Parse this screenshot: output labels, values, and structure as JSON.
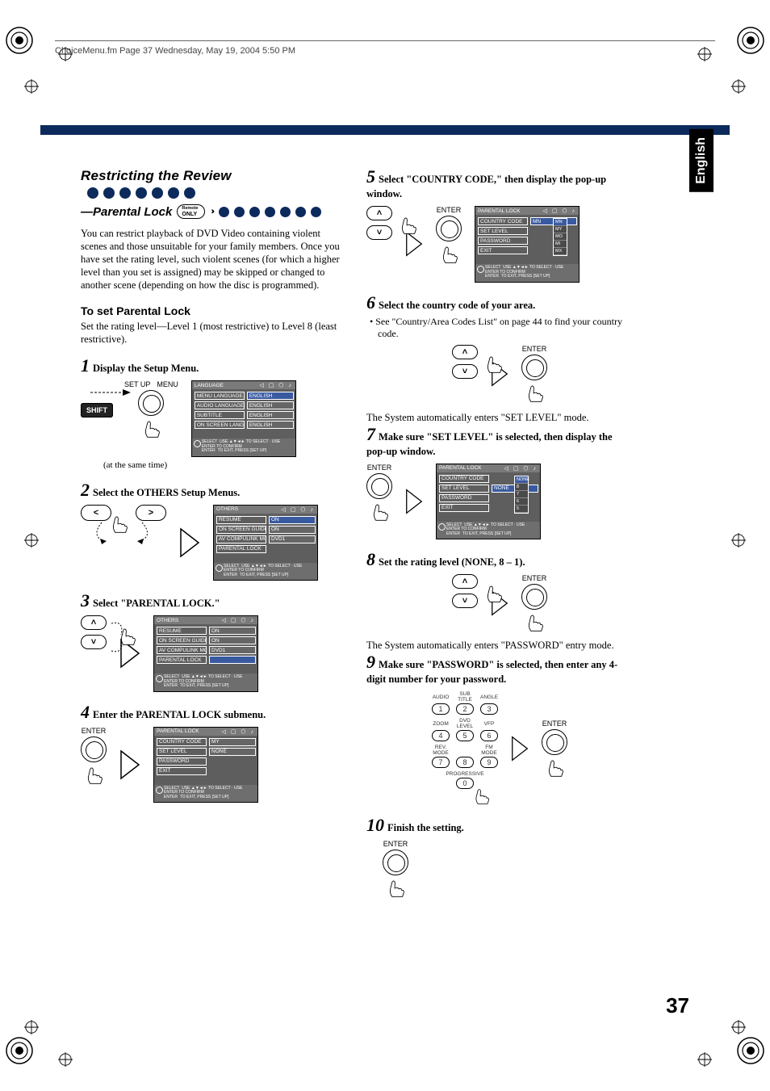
{
  "page_header": "ChoiceMenu.fm  Page 37  Wednesday, May 19, 2004  5:50 PM",
  "tab": "English",
  "page_number": "37",
  "section": {
    "title": "Restricting the Review",
    "subtitle_prefix": "—Parental Lock",
    "remote_badge_top": "Remote",
    "remote_badge_bottom": "ONLY",
    "intro": "You can restrict playback of DVD Video containing violent scenes and those unsuitable for your family members. Once you have set the rating level, such violent scenes (for which a higher level than you set is assigned) may be skipped or changed to another scene (depending on how the disc is programmed).",
    "subhead": "To set Parental Lock",
    "subhead_body": "Set the rating level—Level 1 (most restrictive) to Level 8 (least restrictive)."
  },
  "steps": {
    "s1": {
      "num": "1",
      "text": "Display the Setup Menu.",
      "caption": "(at the same time)",
      "btn_shift": "SHIFT",
      "lbl_menu": "MENU",
      "lbl_setup": "SET UP"
    },
    "s2": {
      "num": "2",
      "text": "Select the OTHERS Setup Menus."
    },
    "s3": {
      "num": "3",
      "text": "Select \"PARENTAL LOCK.\""
    },
    "s4": {
      "num": "4",
      "text": "Enter the PARENTAL LOCK submenu.",
      "lbl_enter": "ENTER"
    },
    "s5": {
      "num": "5",
      "text": "Select \"COUNTRY CODE,\" then display the pop-up window.",
      "lbl_enter": "ENTER"
    },
    "s6": {
      "num": "6",
      "text": "Select the country code of your area.",
      "bullet": "• See \"Country/Area Codes List\" on page 44  to find your country code.",
      "lbl_enter": "ENTER"
    },
    "s7": {
      "pre": "The System automatically enters \"SET  LEVEL\" mode.",
      "num": "7",
      "text": "Make sure \"SET LEVEL\" is selected, then display the pop-up window.",
      "lbl_enter": "ENTER"
    },
    "s8": {
      "num": "8",
      "text": "Set the rating level (NONE, 8 – 1).",
      "lbl_enter": "ENTER"
    },
    "s9": {
      "pre": "The System automatically enters \"PASSWORD\" entry mode.",
      "num": "9",
      "text": "Make sure \"PASSWORD\" is selected, then enter any 4-digit number for your password.",
      "lbl_enter": "ENTER"
    },
    "s10": {
      "num": "10",
      "text": "Finish the setting.",
      "lbl_enter": "ENTER"
    }
  },
  "screens": {
    "footer_l1": "USE ▲▼◄► TO SELECT · USE ENTER TO CONFIRM",
    "footer_l2": "TO EXIT, PRESS [SET UP]",
    "footer_prefix1": "SELECT",
    "footer_prefix2": "ENTER",
    "language": {
      "title": "LANGUAGE",
      "rows": [
        {
          "k": "MENU LANGUAGE",
          "v": "ENGLISH",
          "hl": true
        },
        {
          "k": "AUDIO LANGUAGE",
          "v": "ENGLISH"
        },
        {
          "k": "SUBTITLE",
          "v": "ENGLISH"
        },
        {
          "k": "ON SCREEN LANGUAGE",
          "v": "ENGLISH"
        }
      ]
    },
    "others2": {
      "title": "OTHERS",
      "rows": [
        {
          "k": "RESUME",
          "v": "ON",
          "hl": true
        },
        {
          "k": "ON SCREEN GUIDE",
          "v": "ON"
        },
        {
          "k": "AV COMPULINK MODE",
          "v": "DVD1"
        },
        {
          "k": "PARENTAL LOCK",
          "v": ""
        }
      ]
    },
    "others3": {
      "title": "OTHERS",
      "rows": [
        {
          "k": "RESUME",
          "v": "ON"
        },
        {
          "k": "ON SCREEN GUIDE",
          "v": "ON"
        },
        {
          "k": "AV COMPULINK MODE",
          "v": "DVD1"
        },
        {
          "k": "PARENTAL LOCK",
          "v": "",
          "hl": true
        }
      ]
    },
    "plock_default": {
      "title": "PARENTAL LOCK",
      "rows": [
        {
          "k": "COUNTRY CODE",
          "v": "MY"
        },
        {
          "k": "SET LEVEL",
          "v": "NONE"
        },
        {
          "k": "PASSWORD",
          "v": ""
        },
        {
          "k": "EXIT",
          "v": ""
        }
      ]
    },
    "plock_country": {
      "title": "PARENTAL LOCK",
      "rows": [
        {
          "k": "COUNTRY CODE",
          "v": "MN",
          "hl": true
        },
        {
          "k": "SET LEVEL",
          "v": ""
        },
        {
          "k": "PASSWORD",
          "v": ""
        },
        {
          "k": "EXIT",
          "v": ""
        }
      ],
      "popup": [
        "MN",
        "MY",
        "MO",
        "MI",
        "MX"
      ]
    },
    "plock_level": {
      "title": "PARENTAL LOCK",
      "rows": [
        {
          "k": "COUNTRY CODE",
          "v": ""
        },
        {
          "k": "SET LEVEL",
          "v": "NONE",
          "hl": true
        },
        {
          "k": "PASSWORD",
          "v": ""
        },
        {
          "k": "EXIT",
          "v": ""
        }
      ],
      "popup": [
        "NONE",
        "8",
        "7",
        "6",
        "5"
      ]
    }
  },
  "numpad": {
    "r1_lbl": [
      "AUDIO",
      "SUB TITLE",
      "ANGLE"
    ],
    "r1": [
      "1",
      "2",
      "3"
    ],
    "r2_lbl": [
      "ZOOM",
      "DVD LEVEL",
      "VFP"
    ],
    "r2": [
      "4",
      "5",
      "6"
    ],
    "r3_lbl": [
      "REV. MODE",
      "",
      "FM MODE"
    ],
    "r3": [
      "7",
      "8",
      "9"
    ],
    "r4_lbl": "PROGRESSIVE",
    "r4": "0"
  }
}
